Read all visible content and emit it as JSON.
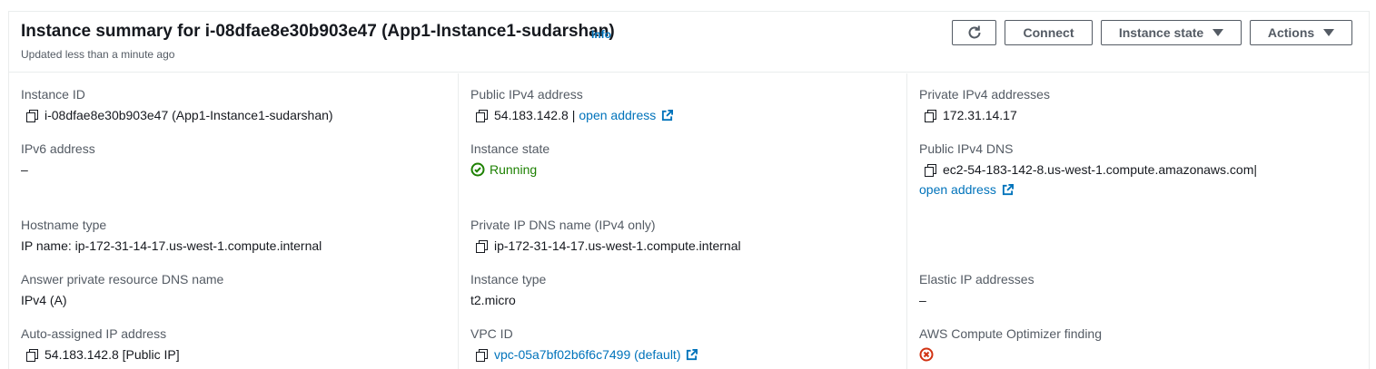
{
  "header": {
    "title": "Instance summary for i-08dfae8e30b903e47 (App1-Instance1-sudarshan)",
    "info": "Info",
    "subtitle": "Updated less than a minute ago",
    "buttons": {
      "refresh_icon": "refresh-icon",
      "connect": "Connect",
      "instance_state": "Instance state",
      "actions": "Actions"
    }
  },
  "fields": {
    "instance_id": {
      "label": "Instance ID",
      "value": "i-08dfae8e30b903e47 (App1-Instance1-sudarshan)"
    },
    "public_ipv4": {
      "label": "Public IPv4 address",
      "value": "54.183.142.8",
      "sep": "|",
      "link": "open address"
    },
    "private_ipv4": {
      "label": "Private IPv4 addresses",
      "value": "172.31.14.17"
    },
    "ipv6": {
      "label": "IPv6 address",
      "value": "–"
    },
    "instance_state": {
      "label": "Instance state",
      "value": "Running"
    },
    "public_dns": {
      "label": "Public IPv4 DNS",
      "value": "ec2-54-183-142-8.us-west-1.compute.amazonaws.com",
      "sep": "|",
      "link": "open address"
    },
    "hostname_type": {
      "label": "Hostname type",
      "value": "IP name: ip-172-31-14-17.us-west-1.compute.internal"
    },
    "private_dns": {
      "label": "Private IP DNS name (IPv4 only)",
      "value": "ip-172-31-14-17.us-west-1.compute.internal"
    },
    "answer_dns": {
      "label": "Answer private resource DNS name",
      "value": "IPv4 (A)"
    },
    "instance_type": {
      "label": "Instance type",
      "value": "t2.micro"
    },
    "elastic_ip": {
      "label": "Elastic IP addresses",
      "value": "–"
    },
    "auto_ip": {
      "label": "Auto-assigned IP address",
      "value": "54.183.142.8 [Public IP]"
    },
    "vpc_id": {
      "label": "VPC ID",
      "value": "vpc-05a7bf02b6f6c7499 (default)"
    },
    "optimizer": {
      "label": "AWS Compute Optimizer finding"
    }
  },
  "colors": {
    "link": "#0073bb",
    "success": "#1d8102",
    "error": "#d13212",
    "label": "#545b64"
  }
}
